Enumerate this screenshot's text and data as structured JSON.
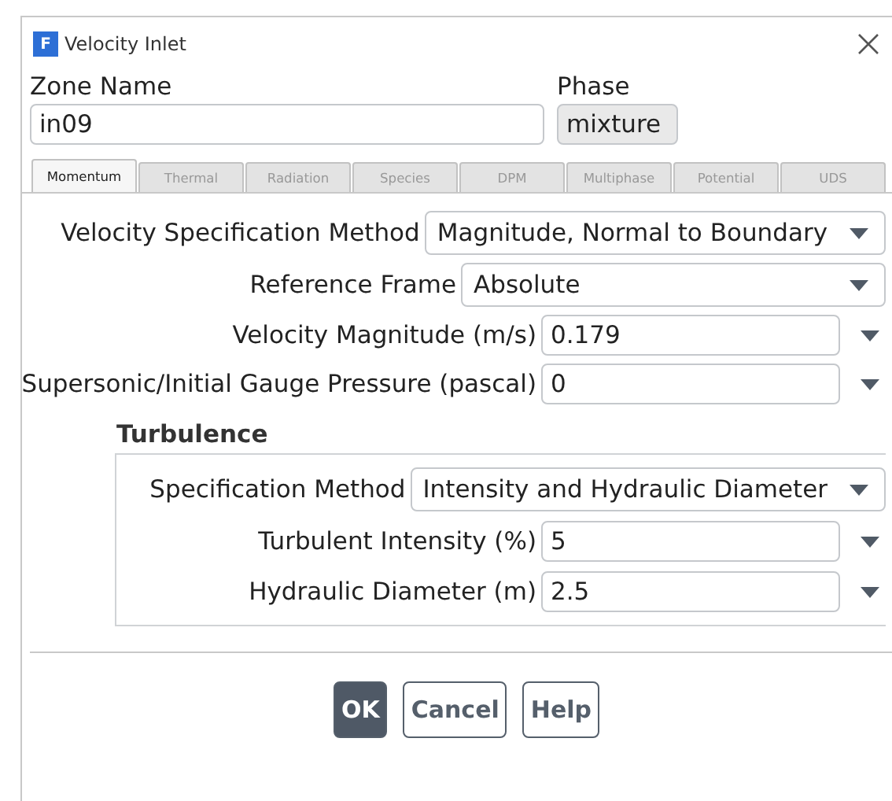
{
  "window": {
    "title": "Velocity Inlet",
    "icon_letter": "F"
  },
  "zone_name": {
    "label": "Zone Name",
    "value": "in09"
  },
  "phase": {
    "label": "Phase",
    "value": "mixture"
  },
  "tabs": [
    {
      "label": "Momentum",
      "selected": true
    },
    {
      "label": "Thermal",
      "selected": false
    },
    {
      "label": "Radiation",
      "selected": false
    },
    {
      "label": "Species",
      "selected": false
    },
    {
      "label": "DPM",
      "selected": false
    },
    {
      "label": "Multiphase",
      "selected": false
    },
    {
      "label": "Potential",
      "selected": false
    },
    {
      "label": "UDS",
      "selected": false
    }
  ],
  "rows": [
    {
      "kind": "dropdown",
      "label": "Velocity Specification Method",
      "value": "Magnitude, Normal to Boundary"
    },
    {
      "kind": "dropdown",
      "label": "Reference Frame",
      "value": "Absolute"
    },
    {
      "kind": "number",
      "label": "Velocity Magnitude (m/s)",
      "value": "0.179"
    },
    {
      "kind": "number",
      "label": "Supersonic/Initial Gauge Pressure (pascal)",
      "value": "0"
    }
  ],
  "turbulence": {
    "title": "Turbulence",
    "rows": [
      {
        "kind": "dropdown",
        "label": "Specification Method",
        "value": "Intensity and Hydraulic Diameter"
      },
      {
        "kind": "number",
        "label": "Turbulent Intensity (%)",
        "value": "5"
      },
      {
        "kind": "number",
        "label": "Hydraulic Diameter (m)",
        "value": "2.5"
      }
    ]
  },
  "buttons": [
    {
      "label": "OK",
      "primary": true
    },
    {
      "label": "Cancel",
      "primary": false
    },
    {
      "label": "Help",
      "primary": false
    }
  ]
}
